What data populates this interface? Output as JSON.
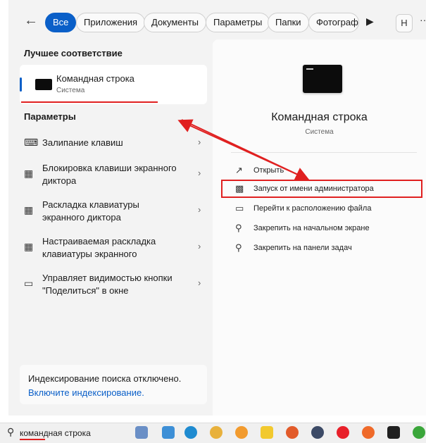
{
  "filters": {
    "all": "Все",
    "apps": "Приложения",
    "documents": "Документы",
    "settings": "Параметры",
    "folders": "Папки",
    "photos": "Фотограф",
    "avatar": "Н"
  },
  "best_match": {
    "heading": "Лучшее соответствие",
    "title": "Командная строка",
    "subtitle": "Система"
  },
  "settings_section": {
    "heading": "Параметры",
    "items": [
      {
        "label": "Залипание клавиш"
      },
      {
        "label": "Блокировка клавиши экранного диктора"
      },
      {
        "label": "Раскладка клавиатуры экранного диктора"
      },
      {
        "label": "Настраиваемая раскладка клавиатуры экранного"
      },
      {
        "label": "Управляет видимостью кнопки \"Поделиться\" в окне"
      }
    ]
  },
  "indexing": {
    "text": "Индексирование поиска отключено.",
    "link": "Включите индексирование."
  },
  "detail": {
    "title": "Командная строка",
    "subtitle": "Система",
    "actions": [
      {
        "label": "Открыть"
      },
      {
        "label": "Запуск от имени администратора"
      },
      {
        "label": "Перейти к расположению файла"
      },
      {
        "label": "Закрепить на начальном экране"
      },
      {
        "label": "Закрепить на панели задач"
      }
    ]
  },
  "taskbar": {
    "search_value": "командная строка"
  },
  "colors": {
    "accent": "#0a5fc8",
    "annotation": "#e02020"
  }
}
